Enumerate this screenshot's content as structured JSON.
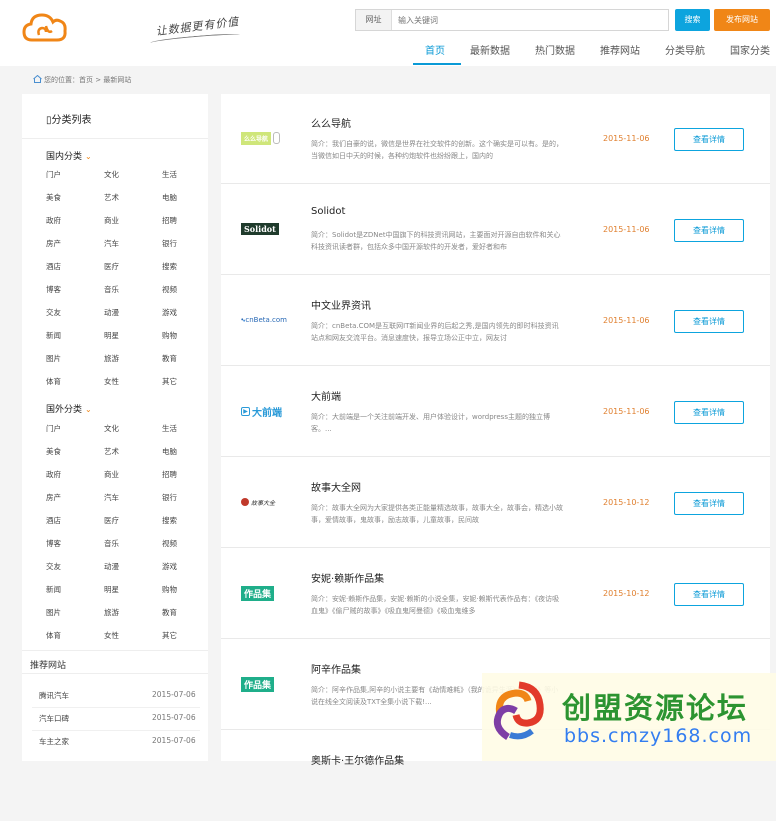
{
  "header": {
    "slogan": "让数据更有价值",
    "search": {
      "scope": "网址",
      "placeholder": "输入关键词"
    },
    "search_button": "搜索",
    "publish_button": "发布网站",
    "nav": [
      "首页",
      "最新数据",
      "热门数据",
      "推荐网站",
      "分类导航",
      "国家分类"
    ]
  },
  "breadcrumb": "您的位置：首页 > 最新网站",
  "sidebar": {
    "title": "▯分类列表",
    "domestic": {
      "label": "国内分类",
      "items": [
        "门户",
        "文化",
        "生活",
        "美食",
        "艺术",
        "电脑",
        "政府",
        "商业",
        "招聘",
        "房产",
        "汽车",
        "银行",
        "酒店",
        "医疗",
        "搜索",
        "博客",
        "音乐",
        "视频",
        "交友",
        "动漫",
        "游戏",
        "新闻",
        "明星",
        "购物",
        "图片",
        "旅游",
        "教育",
        "体育",
        "女性",
        "其它"
      ]
    },
    "foreign": {
      "label": "国外分类",
      "items": [
        "门户",
        "文化",
        "生活",
        "美食",
        "艺术",
        "电脑",
        "政府",
        "商业",
        "招聘",
        "房产",
        "汽车",
        "银行",
        "酒店",
        "医疗",
        "搜索",
        "博客",
        "音乐",
        "视频",
        "交友",
        "动漫",
        "游戏",
        "新闻",
        "明星",
        "购物",
        "图片",
        "旅游",
        "教育",
        "体育",
        "女性",
        "其它"
      ]
    },
    "recommended": {
      "label": "推荐网站",
      "items": [
        {
          "name": "腾讯汽车",
          "date": "2015-07-06"
        },
        {
          "name": "汽车口碑",
          "date": "2015-07-06"
        },
        {
          "name": "车主之家",
          "date": "2015-07-06"
        }
      ]
    }
  },
  "sites": [
    {
      "title": "么么导航",
      "desc": "简介：我们自豪的说，微信是世界在社交软件的创新。这个确实是可以有。是的，当微信如日中天的时候，各种约炮软件也纷纷跟上，国内的",
      "date": "2015-11-06",
      "button": "查看详情",
      "logo": "么么导航"
    },
    {
      "title": "Solidot",
      "desc": "简介：Solidot是ZDNet中国旗下的科技资讯网站，主要面对开源自由软件和关心科技资讯读者群，包括众多中国开源软件的开发者，爱好者和布",
      "date": "2015-11-06",
      "button": "查看详情",
      "logo": "Solidot"
    },
    {
      "title": "中文业界资讯",
      "desc": "简介：cnBeta.COM是互联网IT新闻业界的后起之秀,是国内领先的即时科技资讯站点和网友交流平台。消息速度快，报导立场公正中立，网友讨",
      "date": "2015-11-06",
      "button": "查看详情",
      "logo": "cnBeta.com"
    },
    {
      "title": "大前端",
      "desc": "简介：大前端是一个关注前端开发、用户体验设计，wordpress主题的独立博客。...",
      "date": "2015-11-06",
      "button": "查看详情",
      "logo": "大前端"
    },
    {
      "title": "故事大全网",
      "desc": "简介：故事大全网为大家提供各类正能量精选故事，故事大全，故事会，精选小故事，爱情故事，鬼故事，励志故事，儿童故事，民间故",
      "date": "2015-10-12",
      "button": "查看详情",
      "logo": "故事大全"
    },
    {
      "title": "安妮·赖斯作品集",
      "desc": "简介：安妮·赖斯作品集，安妮·赖斯的小说全集，安妮·赖斯代表作品有：《夜访吸血鬼》《偷尸贼的故事》《吸血鬼阿曼德》《吸血鬼维多",
      "date": "2015-10-12",
      "button": "查看详情",
      "logo": "作品集"
    },
    {
      "title": "阿辛作品集",
      "desc": "简介：阿辛作品集,阿辛的小说主要有《劫情难耗》（我的诡异生涯）（鬼记》等小说在线全文阅读及TXT全集小说下载!...",
      "date": "",
      "button": "",
      "logo": "作品集"
    },
    {
      "title": "奥斯卡·王尔德作品集",
      "desc": "",
      "date": "",
      "button": "",
      "logo": ""
    }
  ],
  "watermark": {
    "title": "创盟资源论坛",
    "url": "bbs.cmzy168.com"
  }
}
